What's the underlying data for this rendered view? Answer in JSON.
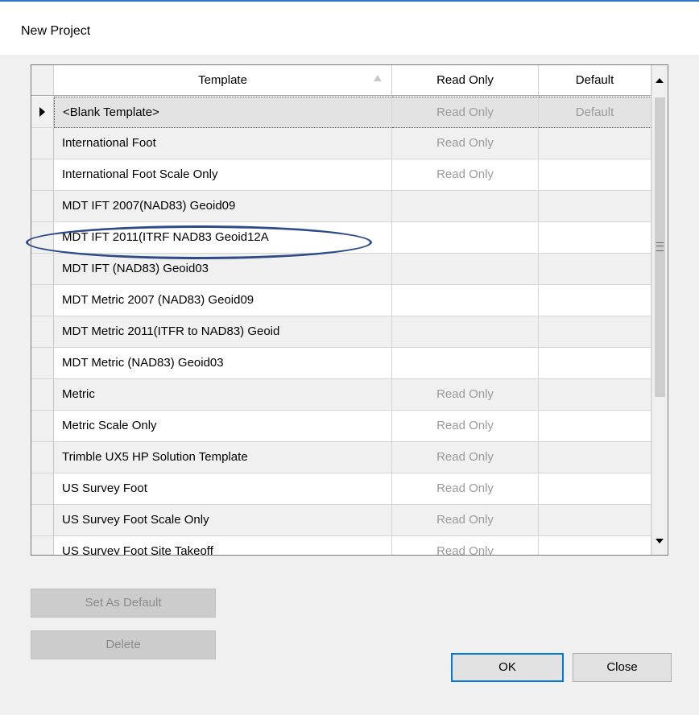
{
  "dialog": {
    "title": "New Project"
  },
  "grid": {
    "columns": {
      "template": "Template",
      "read_only": "Read Only",
      "default": "Default"
    },
    "rows": [
      {
        "template": "<Blank Template>",
        "read_only": "Read Only",
        "default": "Default"
      },
      {
        "template": "International Foot",
        "read_only": "Read Only",
        "default": ""
      },
      {
        "template": "International Foot Scale Only",
        "read_only": "Read Only",
        "default": ""
      },
      {
        "template": "MDT IFT 2007(NAD83) Geoid09",
        "read_only": "",
        "default": ""
      },
      {
        "template": "MDT IFT 2011(ITRF NAD83 Geoid12A",
        "read_only": "",
        "default": ""
      },
      {
        "template": "MDT IFT (NAD83) Geoid03",
        "read_only": "",
        "default": ""
      },
      {
        "template": "MDT Metric 2007 (NAD83) Geoid09",
        "read_only": "",
        "default": ""
      },
      {
        "template": "MDT Metric 2011(ITFR to NAD83) Geoid",
        "read_only": "",
        "default": ""
      },
      {
        "template": "MDT Metric (NAD83) Geoid03",
        "read_only": "",
        "default": ""
      },
      {
        "template": "Metric",
        "read_only": "Read Only",
        "default": ""
      },
      {
        "template": "Metric Scale Only",
        "read_only": "Read Only",
        "default": ""
      },
      {
        "template": "Trimble UX5 HP Solution Template",
        "read_only": "Read Only",
        "default": ""
      },
      {
        "template": "US Survey Foot",
        "read_only": "Read Only",
        "default": ""
      },
      {
        "template": "US Survey Foot Scale Only",
        "read_only": "Read Only",
        "default": ""
      },
      {
        "template": "US Survey Foot Site Takeoff",
        "read_only": "Read Only",
        "default": ""
      }
    ]
  },
  "buttons": {
    "set_default": "Set As Default",
    "delete": "Delete",
    "ok": "OK",
    "close": "Close"
  },
  "colors": {
    "accent": "#0078d7",
    "annotation": "#2e4b86"
  }
}
